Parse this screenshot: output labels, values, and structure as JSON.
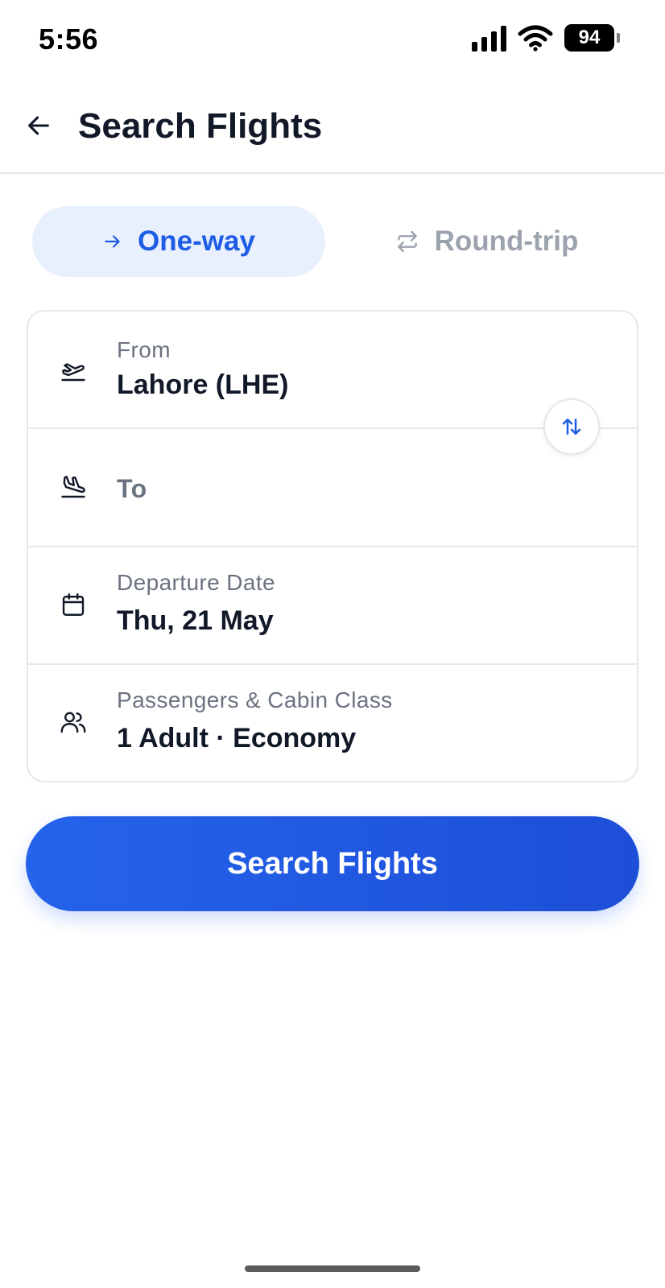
{
  "status_bar": {
    "time": "5:56",
    "battery": "94",
    "icons": [
      "signal-icon",
      "wifi-icon",
      "battery-icon"
    ]
  },
  "header": {
    "title": "Search Flights",
    "back_icon": "arrow-left-icon"
  },
  "trip_type": {
    "tabs": [
      {
        "label": "One-way",
        "icon": "arrow-right-icon",
        "selected": true
      },
      {
        "label": "Round-trip",
        "icon": "repeat-icon",
        "selected": false
      }
    ]
  },
  "form": {
    "from": {
      "label": "From",
      "value": "Lahore (LHE)",
      "icon": "plane-takeoff-icon"
    },
    "to": {
      "placeholder": "To",
      "icon": "plane-landing-icon"
    },
    "departure": {
      "label": "Departure Date",
      "value": "Thu, 21 May",
      "icon": "calendar-icon"
    },
    "passengers": {
      "label": "Passengers & Cabin Class",
      "value": "1 Adult · Economy",
      "icon": "users-icon"
    },
    "swap_icon": "swap-vertical-icon"
  },
  "search_button": {
    "label": "Search Flights"
  },
  "colors": {
    "accent": "#1d5ce5",
    "accent_light": "#e8effd",
    "muted_text": "#6b7280",
    "inactive_tab": "#9ca3af"
  }
}
